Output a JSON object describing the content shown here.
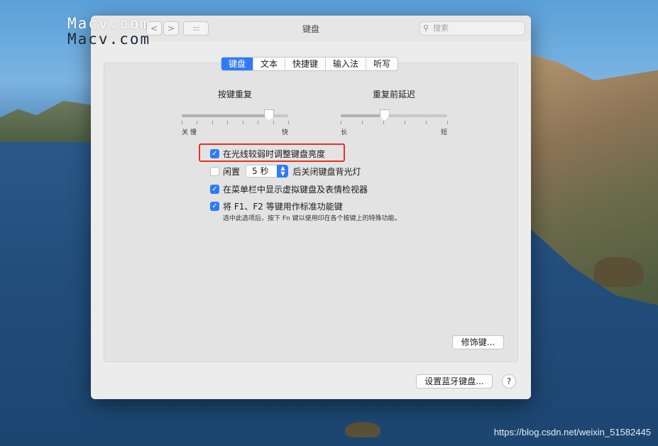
{
  "watermark": {
    "line1": "Macv.com",
    "line2": "Macv.com",
    "footer": "https://blog.csdn.net/weixin_51582445"
  },
  "window": {
    "title": "键盘",
    "search_placeholder": "搜索",
    "nav": {
      "back": "<",
      "forward": ">",
      "grid": "::::"
    },
    "icons": {
      "search": "search-icon",
      "back": "chevron-left-icon",
      "forward": "chevron-right-icon",
      "grid": "grid-icon",
      "check": "checkmark-icon",
      "stepper": "stepper-arrows-icon"
    }
  },
  "tabs": [
    {
      "label": "键盘",
      "active": true
    },
    {
      "label": "文本",
      "active": false
    },
    {
      "label": "快捷键",
      "active": false
    },
    {
      "label": "输入法",
      "active": false
    },
    {
      "label": "听写",
      "active": false
    }
  ],
  "sliders": {
    "key_repeat": {
      "label": "按键重复",
      "min_label": "关 慢",
      "max_label": "快",
      "value_fraction": 0.82
    },
    "delay": {
      "label": "重复前延迟",
      "min_label": "长",
      "max_label": "短",
      "value_fraction": 0.41
    }
  },
  "options": {
    "adjust_brightness": {
      "label": "在光线较弱时调整键盘亮度",
      "checked": true
    },
    "idle_off": {
      "prefix": "闲置",
      "value": "5 秒",
      "suffix": "后关闭键盘背光灯",
      "checked": false
    },
    "show_viewer": {
      "label": "在菜单栏中显示虚拟键盘及表情检视器",
      "checked": true
    },
    "fn_keys": {
      "label": "将 F1、F2 等键用作标准功能键",
      "checked": true,
      "description": "选中此选项后，按下 Fn 键以使用印在各个按键上的特殊功能。"
    }
  },
  "buttons": {
    "modifier": "修饰键...",
    "bluetooth": "设置蓝牙键盘...",
    "help": "?"
  },
  "colors": {
    "accent": "#2f7bf6",
    "highlight_box": "#e8321f"
  }
}
